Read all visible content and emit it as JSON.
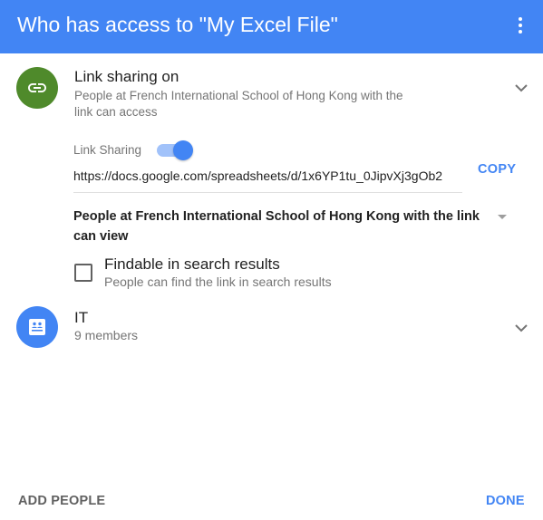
{
  "header": {
    "title": "Who has access to \"My Excel File\"",
    "menu_icon": "more-vert-icon",
    "background_color": "#4285f4"
  },
  "link_sharing": {
    "icon": "link-icon",
    "icon_color": "#4f8a2b",
    "title": "Link sharing on",
    "description_line1": "People at French International School of Hong Kong with the",
    "description_line2": "link can access",
    "toggle_label": "Link Sharing",
    "toggle_on": true,
    "url": "https://docs.google.com/spreadsheets/d/1x6YP1tu_0JipvXj3gOb2",
    "copy_label": "COPY",
    "access_level": "People at French International School of Hong Kong with the link can view",
    "findable_label": "Findable in search results",
    "findable_sublabel": "People can find the link in search results",
    "findable_checked": false
  },
  "group": {
    "icon": "group-icon",
    "icon_color": "#4285f4",
    "name": "IT",
    "members": "9 members"
  },
  "footer": {
    "add_people_label": "ADD PEOPLE",
    "done_label": "DONE",
    "accent_color": "#4285f4"
  }
}
